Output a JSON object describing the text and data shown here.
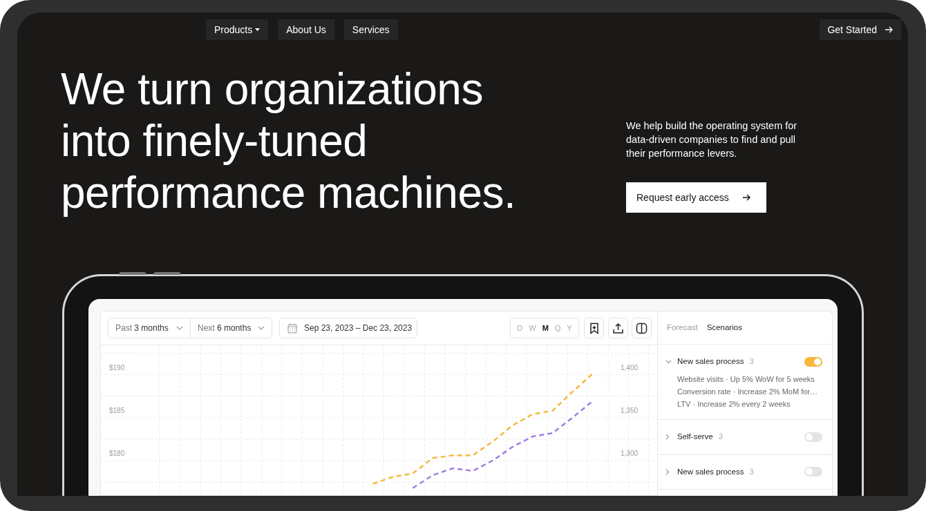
{
  "nav": {
    "items": [
      {
        "label": "Products",
        "has_caret": true
      },
      {
        "label": "About Us",
        "has_caret": false
      },
      {
        "label": "Services",
        "has_caret": false
      }
    ],
    "cta": {
      "label": "Get Started"
    }
  },
  "hero": {
    "headline_lines": [
      "We turn organizations",
      "into finely-tuned",
      "performance machines."
    ],
    "description": "We help build the operating system for data-driven companies to find and pull their performance levers.",
    "button": {
      "label": "Request early access"
    }
  },
  "dashboard": {
    "range_selects": [
      {
        "prefix": "Past",
        "value": "3 months"
      },
      {
        "prefix": "Next",
        "value": "6 months"
      }
    ],
    "date_range": "Sep 23, 2023 – Dec 23, 2023",
    "granularity": [
      {
        "label": "D",
        "selected": false
      },
      {
        "label": "W",
        "selected": false
      },
      {
        "label": "M",
        "selected": true
      },
      {
        "label": "Q",
        "selected": false
      },
      {
        "label": "Y",
        "selected": false
      }
    ],
    "left_axis_labels": [
      "$190",
      "$185",
      "$180"
    ],
    "chart_data": {
      "type": "line",
      "grid": true,
      "ylim": [
        1259,
        1435
      ],
      "series": [
        {
          "color": "#f6b73c",
          "line_style": "dashed",
          "values": [
            null,
            null,
            null,
            null,
            null,
            null,
            null,
            null,
            null,
            null,
            null,
            null,
            null,
            1273,
            1281,
            1285,
            1303,
            1306,
            1306,
            1322,
            1341,
            1354,
            1358,
            1380,
            1401,
            null,
            null,
            null
          ]
        },
        {
          "color": "#a07de0",
          "line_style": "dashed",
          "values": [
            null,
            null,
            null,
            null,
            null,
            null,
            null,
            null,
            null,
            null,
            null,
            null,
            null,
            null,
            null,
            1268,
            1283,
            1291,
            1288,
            1300,
            1316,
            1328,
            1332,
            1350,
            1369,
            null,
            null,
            null
          ]
        }
      ],
      "yticks": [
        {
          "value": 1400,
          "label": "1,400"
        },
        {
          "value": 1350,
          "label": "1,350"
        },
        {
          "value": 1300,
          "label": "1,300"
        }
      ]
    },
    "panel_tabs": [
      {
        "label": "Forecast",
        "selected": false
      },
      {
        "label": "Scenarios",
        "selected": true
      }
    ],
    "scenarios": [
      {
        "name": "New sales process",
        "count": "3",
        "expanded": true,
        "on": true,
        "details": [
          "Website visits · Up 5% WoW for 5 weeks",
          "Conversion rate · Increase 2% MoM for…",
          "LTV · Increase 2% every 2 weeks"
        ]
      },
      {
        "name": "Self-serve",
        "count": "3",
        "expanded": false,
        "on": false
      },
      {
        "name": "New sales process",
        "count": "3",
        "expanded": false,
        "on": false
      }
    ]
  }
}
